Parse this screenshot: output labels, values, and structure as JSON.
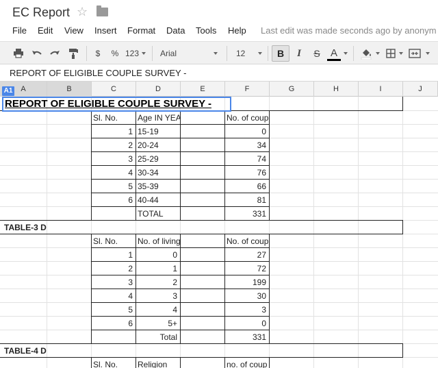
{
  "app": {
    "doc_title": "EC Report",
    "last_edit": "Last edit was made seconds ago by anonym"
  },
  "menu": [
    "File",
    "Edit",
    "View",
    "Insert",
    "Format",
    "Data",
    "Tools",
    "Help"
  ],
  "toolbar": {
    "currency": "$",
    "percent": "%",
    "number_format": "123",
    "font": "Arial",
    "font_size": "12",
    "bold": "B",
    "italic": "I",
    "strike": "S",
    "text_color": "A"
  },
  "formula_bar": {
    "cell_ref": "A1",
    "content": "REPORT OF ELIGIBLE COUPLE SURVEY -"
  },
  "columns": [
    "A",
    "B",
    "C",
    "D",
    "E",
    "F",
    "G",
    "H",
    "I",
    "J"
  ],
  "sheet": {
    "title": "REPORT OF ELIGIBLE COUPLE SURVEY -",
    "table1": {
      "headers": [
        "Sl. No.",
        "Age IN YEA",
        "No. of coup"
      ],
      "rows": [
        [
          "1",
          "15-19",
          "0"
        ],
        [
          "2",
          "20-24",
          "34"
        ],
        [
          "3",
          "25-29",
          "74"
        ],
        [
          "4",
          "30-34",
          "76"
        ],
        [
          "5",
          "35-39",
          "66"
        ],
        [
          "6",
          "40-44",
          "81"
        ]
      ],
      "total_label": "TOTAL",
      "total_value": "331"
    },
    "table3": {
      "label": "TABLE-3 D",
      "headers": [
        "Sl. No.",
        "No. of living",
        "No. of coup"
      ],
      "rows": [
        [
          "1",
          "0",
          "27"
        ],
        [
          "2",
          "1",
          "72"
        ],
        [
          "3",
          "2",
          "199"
        ],
        [
          "4",
          "3",
          "30"
        ],
        [
          "5",
          "4",
          "3"
        ],
        [
          "6",
          "5+",
          "0"
        ]
      ],
      "total_label": "Total",
      "total_value": "331"
    },
    "table4": {
      "label": "TABLE-4 D",
      "headers": [
        "Sl. No.",
        "Religion",
        "no. of coup"
      ]
    }
  }
}
